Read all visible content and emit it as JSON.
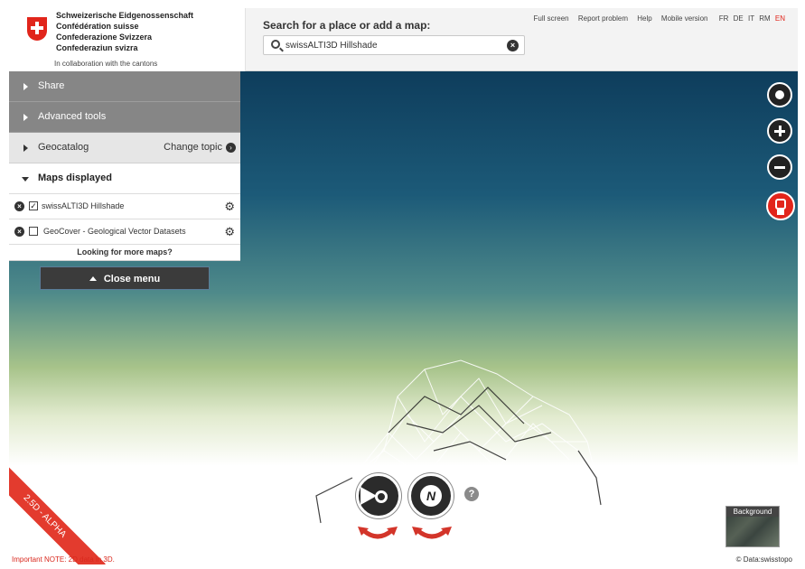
{
  "header": {
    "confederation_lines": [
      "Schweizerische Eidgenossenschaft",
      "Confédération suisse",
      "Confederazione Svizzera",
      "Confederaziun svizra"
    ],
    "collaboration": "In collaboration with the cantons",
    "search_label": "Search for a place or add a map:",
    "search_value": "swissALTI3D Hillshade",
    "links": [
      "Full screen",
      "Report problem",
      "Help",
      "Mobile version"
    ],
    "languages": [
      "FR",
      "DE",
      "IT",
      "RM",
      "EN"
    ],
    "active_language": "EN"
  },
  "menu": {
    "share": "Share",
    "advanced_tools": "Advanced tools",
    "geocatalog": "Geocatalog",
    "change_topic": "Change topic",
    "maps_displayed": "Maps displayed",
    "layers": [
      {
        "label": "swissALTI3D Hillshade",
        "checked": true
      },
      {
        "label": "GeoCover - Geological Vector Datasets",
        "checked": false
      }
    ],
    "more_maps": "Looking for more maps?",
    "close_menu": "Close menu"
  },
  "map": {
    "alpha_badge": "2.5D - ALPHA",
    "notice": "Important NOTE: 2D data in 3D.",
    "background_label": "Background",
    "data_credit": "© Data:swisstopo",
    "compass_letter": "N",
    "help_symbol": "?"
  },
  "icons": {
    "search": "search-icon",
    "clear": "close-circle-icon",
    "gear": "gear-icon",
    "locate": "locate-icon",
    "zoom_in": "plus-icon",
    "zoom_out": "minus-icon",
    "street_view": "pegman-icon"
  },
  "colors": {
    "swiss_red": "#e1251b",
    "menu_dark": "#868686",
    "alpha_red": "#e33b2e"
  }
}
